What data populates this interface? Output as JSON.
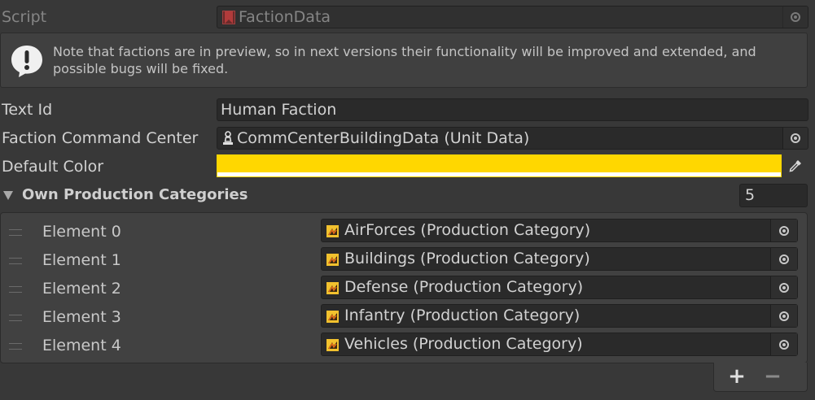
{
  "script_row": {
    "label": "Script",
    "value": "FactionData"
  },
  "note": {
    "text": "Note that factions are in preview, so in next versions their functionality will be improved and extended, and possible bugs will be fixed."
  },
  "text_id": {
    "label": "Text Id",
    "value": "Human Faction"
  },
  "command_center": {
    "label": "Faction Command Center",
    "value": "CommCenterBuildingData (Unit Data)"
  },
  "default_color": {
    "label": "Default Color",
    "color": "#ffd700"
  },
  "categories": {
    "label": "Own Production Categories",
    "size": "5",
    "elements": [
      {
        "label": "Element 0",
        "value": "AirForces (Production Category)"
      },
      {
        "label": "Element 1",
        "value": "Buildings (Production Category)"
      },
      {
        "label": "Element 2",
        "value": "Defense (Production Category)"
      },
      {
        "label": "Element 3",
        "value": "Infantry (Production Category)"
      },
      {
        "label": "Element 4",
        "value": "Vehicles (Production Category)"
      }
    ]
  },
  "footer": {
    "add": "+",
    "remove": "−"
  },
  "icons": {
    "script": "script-file-icon",
    "warning": "exclamation-icon",
    "unit": "chess-pawn-icon",
    "category": "production-category-icon",
    "eyedropper": "eyedropper-icon",
    "picker": "object-picker-icon"
  }
}
